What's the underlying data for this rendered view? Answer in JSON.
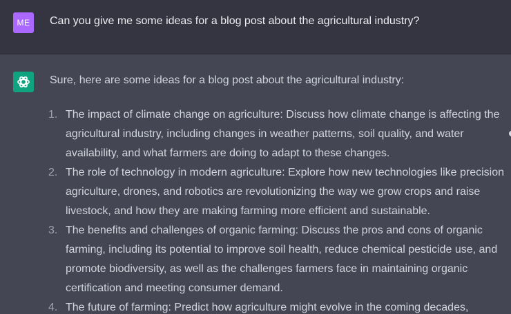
{
  "user_message": {
    "avatar_initials": "ME",
    "avatar_color": "#ab68ff",
    "text": "Can you give me some ideas for a blog post about the agricultural industry?"
  },
  "assistant_message": {
    "avatar_icon": "openai-logo-icon",
    "avatar_color": "#10a37f",
    "intro": "Sure, here are some ideas for a blog post about the agricultural industry:",
    "items": [
      {
        "number": "1.",
        "text": "The impact of climate change on agriculture: Discuss how climate change is affecting the agricultural industry, including changes in weather patterns, soil quality, and water availability, and what farmers are doing to adapt to these changes."
      },
      {
        "number": "2.",
        "text": "The role of technology in modern agriculture: Explore how new technologies like precision agriculture, drones, and robotics are revolutionizing the way we grow crops and raise livestock, and how they are making farming more efficient and sustainable."
      },
      {
        "number": "3.",
        "text": "The benefits and challenges of organic farming: Discuss the pros and cons of organic farming, including its potential to improve soil health, reduce chemical pesticide use, and promote biodiversity, as well as the challenges farmers face in maintaining organic certification and meeting consumer demand."
      },
      {
        "number": "4.",
        "text": "The future of farming: Predict how agriculture might evolve in the coming decades,"
      }
    ]
  },
  "colors": {
    "user_bg": "#343541",
    "assistant_bg": "#444654",
    "text": "#d1d5db"
  }
}
